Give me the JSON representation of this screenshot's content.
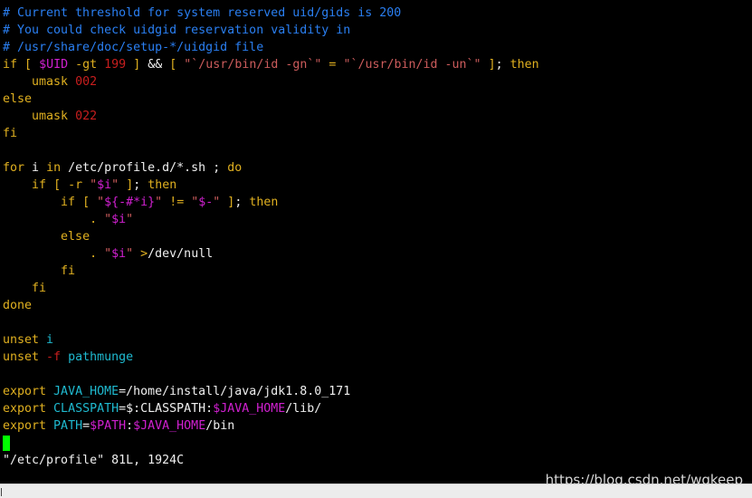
{
  "colors": {
    "background": "#000000",
    "text": "#f0f0f0",
    "comment": "#2a7ff2",
    "keyword": "#e0b020",
    "number": "#c81e1e",
    "string": "#cc5c5c",
    "variable": "#d020d0",
    "builtin": "#1fbad0",
    "cursor": "#00ff00",
    "watermark": "#d8d8d8"
  },
  "lines": [
    [
      {
        "t": "# Current threshold for system reserved uid/gids is 200",
        "c": "comment"
      }
    ],
    [
      {
        "t": "# You could check uidgid reservation validity in",
        "c": "comment"
      }
    ],
    [
      {
        "t": "# /usr/share/doc/setup-*/uidgid file",
        "c": "comment"
      }
    ],
    [
      {
        "t": "if",
        "c": "keyword"
      },
      {
        "t": " ",
        "c": "text"
      },
      {
        "t": "[",
        "c": "keyword"
      },
      {
        "t": " ",
        "c": "text"
      },
      {
        "t": "$UID",
        "c": "variable"
      },
      {
        "t": " ",
        "c": "text"
      },
      {
        "t": "-gt",
        "c": "keyword"
      },
      {
        "t": " ",
        "c": "text"
      },
      {
        "t": "199",
        "c": "number"
      },
      {
        "t": " ",
        "c": "text"
      },
      {
        "t": "]",
        "c": "keyword"
      },
      {
        "t": " && ",
        "c": "text"
      },
      {
        "t": "[",
        "c": "keyword"
      },
      {
        "t": " ",
        "c": "text"
      },
      {
        "t": "\"`/usr/bin/id -gn`\"",
        "c": "string"
      },
      {
        "t": " ",
        "c": "text"
      },
      {
        "t": "=",
        "c": "keyword"
      },
      {
        "t": " ",
        "c": "text"
      },
      {
        "t": "\"`/usr/bin/id -un`\"",
        "c": "string"
      },
      {
        "t": " ",
        "c": "text"
      },
      {
        "t": "]",
        "c": "keyword"
      },
      {
        "t": "; ",
        "c": "text"
      },
      {
        "t": "then",
        "c": "keyword"
      }
    ],
    [
      {
        "t": "    umask ",
        "c": "keyword"
      },
      {
        "t": "002",
        "c": "number"
      }
    ],
    [
      {
        "t": "else",
        "c": "keyword"
      }
    ],
    [
      {
        "t": "    umask ",
        "c": "keyword"
      },
      {
        "t": "022",
        "c": "number"
      }
    ],
    [
      {
        "t": "fi",
        "c": "keyword"
      }
    ],
    [],
    [
      {
        "t": "for",
        "c": "keyword"
      },
      {
        "t": " i ",
        "c": "text"
      },
      {
        "t": "in",
        "c": "keyword"
      },
      {
        "t": " /etc/profile.d/*.sh ; ",
        "c": "text"
      },
      {
        "t": "do",
        "c": "keyword"
      }
    ],
    [
      {
        "t": "    ",
        "c": "text"
      },
      {
        "t": "if",
        "c": "keyword"
      },
      {
        "t": " ",
        "c": "text"
      },
      {
        "t": "[",
        "c": "keyword"
      },
      {
        "t": " ",
        "c": "text"
      },
      {
        "t": "-r",
        "c": "keyword"
      },
      {
        "t": " ",
        "c": "text"
      },
      {
        "t": "\"",
        "c": "string"
      },
      {
        "t": "$i",
        "c": "variable"
      },
      {
        "t": "\"",
        "c": "string"
      },
      {
        "t": " ",
        "c": "text"
      },
      {
        "t": "]",
        "c": "keyword"
      },
      {
        "t": "; ",
        "c": "text"
      },
      {
        "t": "then",
        "c": "keyword"
      }
    ],
    [
      {
        "t": "        ",
        "c": "text"
      },
      {
        "t": "if",
        "c": "keyword"
      },
      {
        "t": " ",
        "c": "text"
      },
      {
        "t": "[",
        "c": "keyword"
      },
      {
        "t": " ",
        "c": "text"
      },
      {
        "t": "\"",
        "c": "string"
      },
      {
        "t": "${-#*i}",
        "c": "variable"
      },
      {
        "t": "\"",
        "c": "string"
      },
      {
        "t": " ",
        "c": "text"
      },
      {
        "t": "!=",
        "c": "keyword"
      },
      {
        "t": " ",
        "c": "text"
      },
      {
        "t": "\"",
        "c": "string"
      },
      {
        "t": "$-",
        "c": "variable"
      },
      {
        "t": "\"",
        "c": "string"
      },
      {
        "t": " ",
        "c": "text"
      },
      {
        "t": "]",
        "c": "keyword"
      },
      {
        "t": "; ",
        "c": "text"
      },
      {
        "t": "then",
        "c": "keyword"
      }
    ],
    [
      {
        "t": "            . ",
        "c": "keyword"
      },
      {
        "t": "\"",
        "c": "string"
      },
      {
        "t": "$i",
        "c": "variable"
      },
      {
        "t": "\"",
        "c": "string"
      }
    ],
    [
      {
        "t": "        ",
        "c": "text"
      },
      {
        "t": "else",
        "c": "keyword"
      }
    ],
    [
      {
        "t": "            . ",
        "c": "keyword"
      },
      {
        "t": "\"",
        "c": "string"
      },
      {
        "t": "$i",
        "c": "variable"
      },
      {
        "t": "\"",
        "c": "string"
      },
      {
        "t": " ",
        "c": "text"
      },
      {
        "t": ">",
        "c": "keyword"
      },
      {
        "t": "/dev/null",
        "c": "text"
      }
    ],
    [
      {
        "t": "        ",
        "c": "text"
      },
      {
        "t": "fi",
        "c": "keyword"
      }
    ],
    [
      {
        "t": "    ",
        "c": "text"
      },
      {
        "t": "fi",
        "c": "keyword"
      }
    ],
    [
      {
        "t": "done",
        "c": "keyword"
      }
    ],
    [],
    [
      {
        "t": "unset",
        "c": "keyword"
      },
      {
        "t": " i",
        "c": "builtin"
      }
    ],
    [
      {
        "t": "unset",
        "c": "keyword"
      },
      {
        "t": " ",
        "c": "text"
      },
      {
        "t": "-f",
        "c": "number"
      },
      {
        "t": " pathmunge",
        "c": "builtin"
      }
    ],
    [],
    [
      {
        "t": "export",
        "c": "keyword"
      },
      {
        "t": " JAVA_HOME",
        "c": "builtin"
      },
      {
        "t": "=",
        "c": "text"
      },
      {
        "t": "/home/install/java/jdk1.8.0_171",
        "c": "text"
      }
    ],
    [
      {
        "t": "export",
        "c": "keyword"
      },
      {
        "t": " CLASSPATH",
        "c": "builtin"
      },
      {
        "t": "=",
        "c": "text"
      },
      {
        "t": "$:CLASSPATH:",
        "c": "text"
      },
      {
        "t": "$JAVA_HOME",
        "c": "variable"
      },
      {
        "t": "/lib/",
        "c": "text"
      }
    ],
    [
      {
        "t": "export",
        "c": "keyword"
      },
      {
        "t": " PATH",
        "c": "builtin"
      },
      {
        "t": "=",
        "c": "text"
      },
      {
        "t": "$PATH",
        "c": "variable"
      },
      {
        "t": ":",
        "c": "text"
      },
      {
        "t": "$JAVA_HOME",
        "c": "variable"
      },
      {
        "t": "/bin",
        "c": "text"
      }
    ]
  ],
  "status_line": "\"/etc/profile\" 81L, 1924C",
  "watermark": "https://blog.csdn.net/wqkeep",
  "scrollbar_marker": "1"
}
